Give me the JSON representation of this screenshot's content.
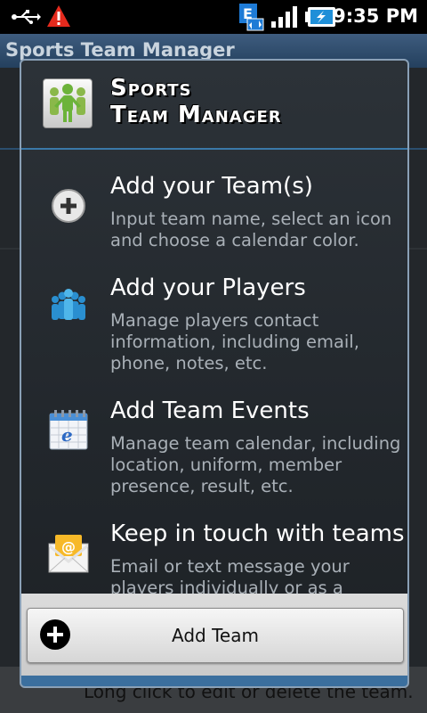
{
  "status_bar": {
    "time": "9:35 PM",
    "icons": [
      "usb-icon",
      "warning-icon",
      "email-sync-icon",
      "signal-icon",
      "battery-charging-icon"
    ]
  },
  "background": {
    "title": "Sports Team Manager",
    "footer_text": "Long click to edit or delete the team."
  },
  "dialog": {
    "app_name_line1": "Sports",
    "app_name_line2": "Team Manager",
    "features": [
      {
        "icon": "add-circle-icon",
        "title": "Add your Team(s)",
        "desc": "Input team name, select an icon and choose a calendar color."
      },
      {
        "icon": "players-group-icon",
        "title": "Add your Players",
        "desc": "Manage players contact information, including email, phone, notes, etc."
      },
      {
        "icon": "calendar-icon",
        "title": "Add Team Events",
        "desc": "Manage team calendar, including location, uniform, member presence, result, etc."
      },
      {
        "icon": "envelope-icon",
        "title": "Keep in touch with teams",
        "desc": "Email or text message your players individually or as a group. Use text"
      }
    ],
    "add_team_label": "Add Team"
  },
  "colors": {
    "accent": "#3b6f9e",
    "dialog_bg": "#22272c",
    "title_bar": "#2f4d6e"
  }
}
